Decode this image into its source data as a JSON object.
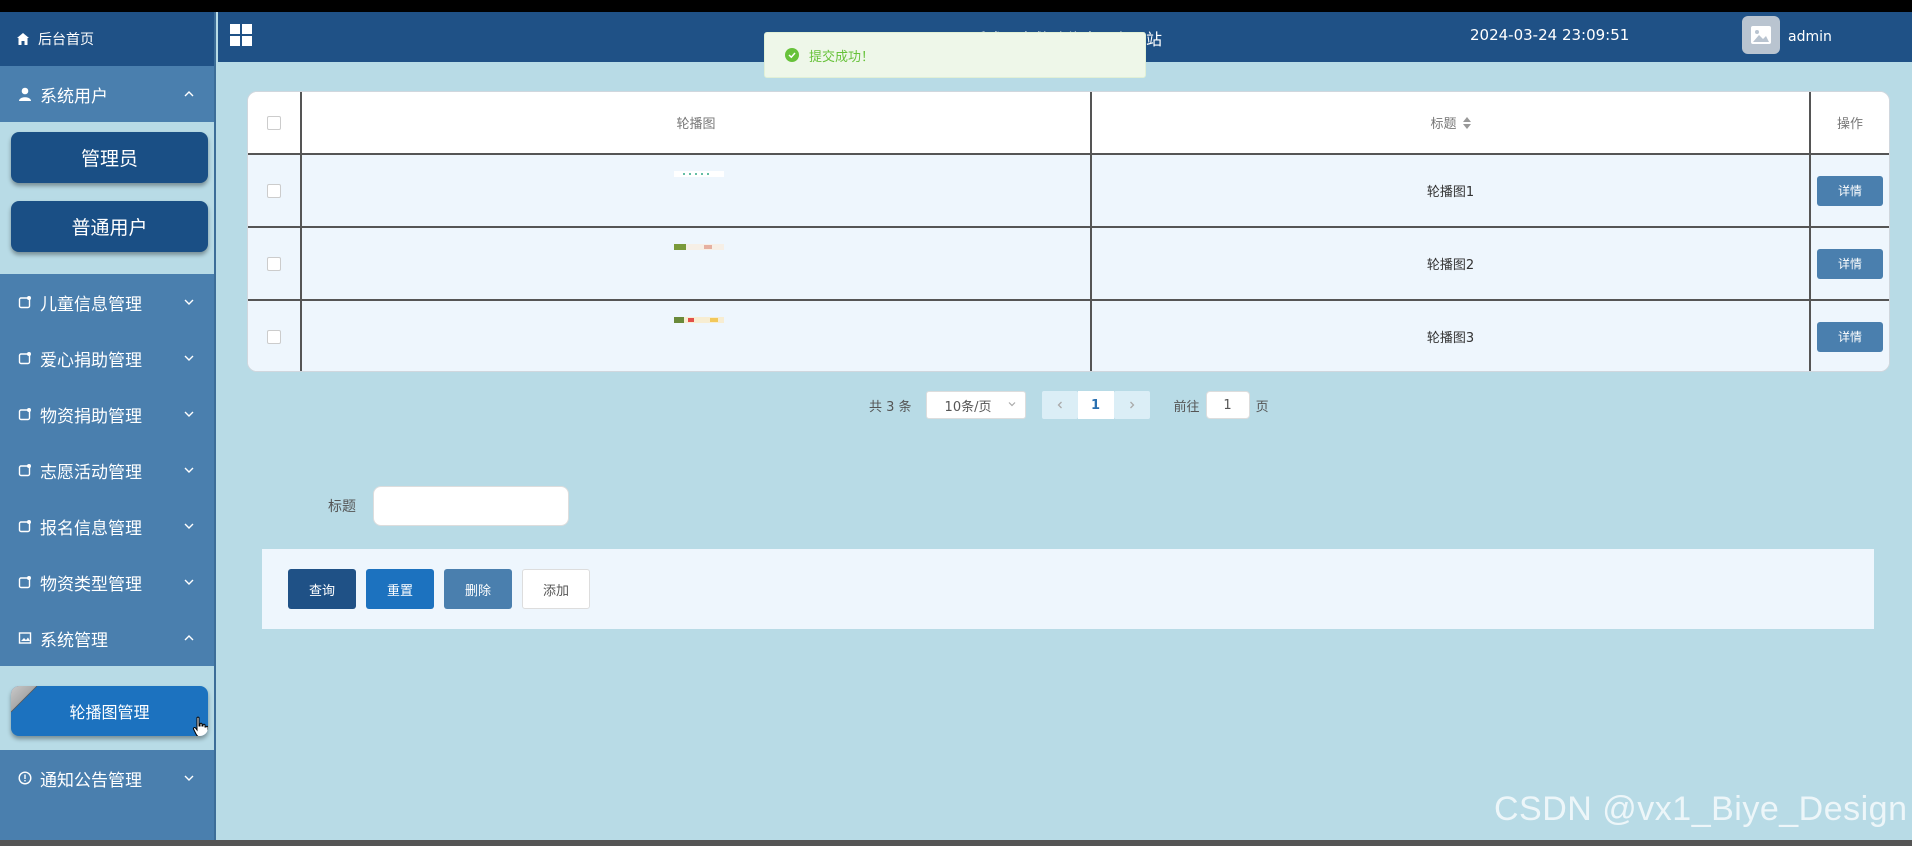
{
  "header": {
    "site_title": "孤残儿童救助信息平台网站",
    "datetime": "2024-03-24 23:09:51",
    "username": "admin"
  },
  "toast": {
    "message": "提交成功！",
    "color": "#67c23a"
  },
  "sidebar": {
    "home": "后台首页",
    "items": [
      {
        "label": "系统用户",
        "expanded": true,
        "sub": [
          "管理员",
          "普通用户"
        ]
      },
      {
        "label": "儿童信息管理"
      },
      {
        "label": "爱心捐助管理"
      },
      {
        "label": "物资捐助管理"
      },
      {
        "label": "志愿活动管理"
      },
      {
        "label": "报名信息管理"
      },
      {
        "label": "物资类型管理"
      },
      {
        "label": "系统管理",
        "expanded": true,
        "sub": [
          "轮播图管理"
        ]
      },
      {
        "label": "通知公告管理"
      }
    ]
  },
  "table": {
    "columns": {
      "image": "轮播图",
      "title": "标题",
      "operation": "操作"
    },
    "rows": [
      {
        "title": "轮播图1",
        "action": "详情"
      },
      {
        "title": "轮播图2",
        "action": "详情"
      },
      {
        "title": "轮播图3",
        "action": "详情"
      }
    ]
  },
  "pagination": {
    "total_text": "共 3 条",
    "page_size": "10条/页",
    "current_page": "1",
    "goto_prefix": "前往",
    "goto_value": "1",
    "goto_suffix": "页"
  },
  "search": {
    "label": "标题",
    "value": ""
  },
  "actions": {
    "query": "查询",
    "reset": "重置",
    "delete": "删除",
    "add": "添加"
  },
  "watermark": "CSDN @vx1_Biye_Design",
  "colors": {
    "sidebar": "#4a7fae",
    "header": "#1f5186",
    "background": "#b8dbe6",
    "accent": "#1c72bf"
  }
}
